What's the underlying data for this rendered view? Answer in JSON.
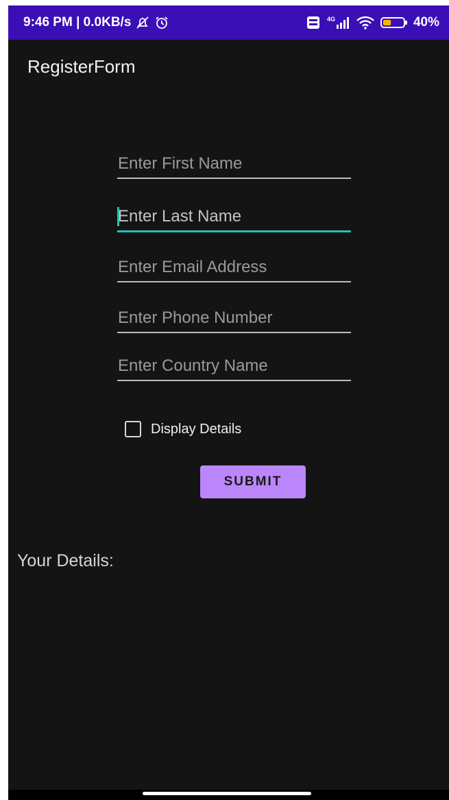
{
  "status_bar": {
    "time_speed": "9:46 PM | 0.0KB/s",
    "network": "4G",
    "battery": "40%",
    "battery_level": 0.4
  },
  "app": {
    "title": "RegisterForm"
  },
  "form": {
    "fields": [
      {
        "placeholder": "Enter First Name",
        "value": ""
      },
      {
        "placeholder": "Enter Last Name",
        "value": ""
      },
      {
        "placeholder": "Enter Email Address",
        "value": ""
      },
      {
        "placeholder": "Enter Phone Number",
        "value": ""
      },
      {
        "placeholder": "Enter Country Name",
        "value": ""
      }
    ],
    "checkbox_label": "Display Details",
    "checkbox_checked": false,
    "submit_label": "SUBMIT"
  },
  "details": {
    "label": "Your Details:"
  },
  "colors": {
    "status_bar": "#3b0fb6",
    "background": "#141414",
    "accent": "#1ec3b6",
    "button": "#bb86fc"
  },
  "icons": [
    "mute-icon",
    "alarm-icon",
    "volte-icon",
    "signal-icon",
    "wifi-icon",
    "battery-icon"
  ]
}
